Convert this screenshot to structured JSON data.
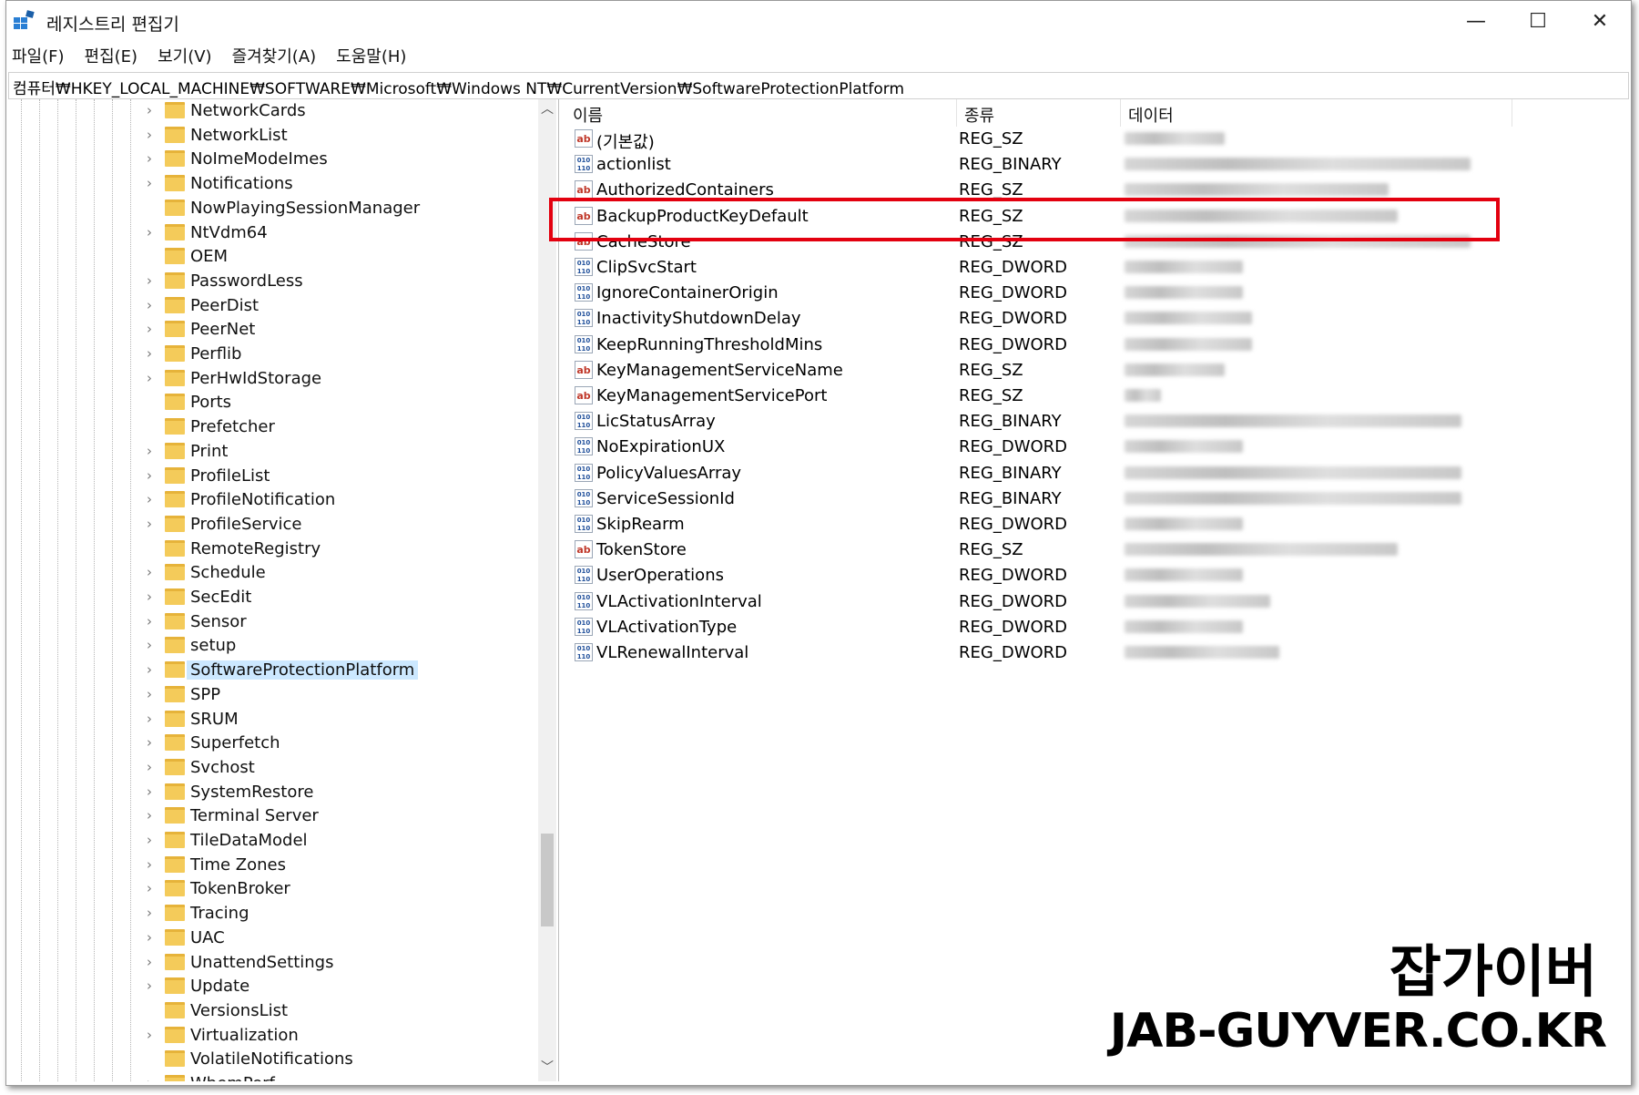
{
  "window": {
    "title": "레지스트리 편집기",
    "controls": {
      "minimize": "—",
      "maximize": "☐",
      "close": "✕"
    }
  },
  "menu": [
    "파일(F)",
    "편집(E)",
    "보기(V)",
    "즐겨찾기(A)",
    "도움말(H)"
  ],
  "address": "컴퓨터₩HKEY_LOCAL_MACHINE₩SOFTWARE₩Microsoft₩Windows NT₩CurrentVersion₩SoftwareProtectionPlatform",
  "tree": {
    "items": [
      {
        "label": "NetworkCards",
        "expandable": true
      },
      {
        "label": "NetworkList",
        "expandable": true
      },
      {
        "label": "NoImeModeImes",
        "expandable": true
      },
      {
        "label": "Notifications",
        "expandable": true
      },
      {
        "label": "NowPlayingSessionManager",
        "expandable": false
      },
      {
        "label": "NtVdm64",
        "expandable": true
      },
      {
        "label": "OEM",
        "expandable": false
      },
      {
        "label": "PasswordLess",
        "expandable": true
      },
      {
        "label": "PeerDist",
        "expandable": true
      },
      {
        "label": "PeerNet",
        "expandable": true
      },
      {
        "label": "Perflib",
        "expandable": true
      },
      {
        "label": "PerHwIdStorage",
        "expandable": true
      },
      {
        "label": "Ports",
        "expandable": false
      },
      {
        "label": "Prefetcher",
        "expandable": false
      },
      {
        "label": "Print",
        "expandable": true
      },
      {
        "label": "ProfileList",
        "expandable": true
      },
      {
        "label": "ProfileNotification",
        "expandable": true
      },
      {
        "label": "ProfileService",
        "expandable": true
      },
      {
        "label": "RemoteRegistry",
        "expandable": false
      },
      {
        "label": "Schedule",
        "expandable": true
      },
      {
        "label": "SecEdit",
        "expandable": true
      },
      {
        "label": "Sensor",
        "expandable": true
      },
      {
        "label": "setup",
        "expandable": true
      },
      {
        "label": "SoftwareProtectionPlatform",
        "expandable": true,
        "selected": true
      },
      {
        "label": "SPP",
        "expandable": true
      },
      {
        "label": "SRUM",
        "expandable": true
      },
      {
        "label": "Superfetch",
        "expandable": true
      },
      {
        "label": "Svchost",
        "expandable": true
      },
      {
        "label": "SystemRestore",
        "expandable": true
      },
      {
        "label": "Terminal Server",
        "expandable": true
      },
      {
        "label": "TileDataModel",
        "expandable": true
      },
      {
        "label": "Time Zones",
        "expandable": true
      },
      {
        "label": "TokenBroker",
        "expandable": true
      },
      {
        "label": "Tracing",
        "expandable": true
      },
      {
        "label": "UAC",
        "expandable": true
      },
      {
        "label": "UnattendSettings",
        "expandable": true
      },
      {
        "label": "Update",
        "expandable": true
      },
      {
        "label": "VersionsList",
        "expandable": false
      },
      {
        "label": "Virtualization",
        "expandable": true
      },
      {
        "label": "VolatileNotifications",
        "expandable": false
      },
      {
        "label": "WbemPerf",
        "expandable": true
      }
    ]
  },
  "list": {
    "headers": {
      "name": "이름",
      "type": "종류",
      "data": "데이터"
    },
    "rows": [
      {
        "name": "(기본값)",
        "type": "REG_SZ",
        "icon": "ab"
      },
      {
        "name": "actionlist",
        "type": "REG_BINARY",
        "icon": "bin"
      },
      {
        "name": "AuthorizedContainers",
        "type": "REG_SZ",
        "icon": "ab"
      },
      {
        "name": "BackupProductKeyDefault",
        "type": "REG_SZ",
        "icon": "ab"
      },
      {
        "name": "CacheStore",
        "type": "REG_SZ",
        "icon": "ab"
      },
      {
        "name": "ClipSvcStart",
        "type": "REG_DWORD",
        "icon": "bin"
      },
      {
        "name": "IgnoreContainerOrigin",
        "type": "REG_DWORD",
        "icon": "bin"
      },
      {
        "name": "InactivityShutdownDelay",
        "type": "REG_DWORD",
        "icon": "bin"
      },
      {
        "name": "KeepRunningThresholdMins",
        "type": "REG_DWORD",
        "icon": "bin"
      },
      {
        "name": "KeyManagementServiceName",
        "type": "REG_SZ",
        "icon": "ab"
      },
      {
        "name": "KeyManagementServicePort",
        "type": "REG_SZ",
        "icon": "ab"
      },
      {
        "name": "LicStatusArray",
        "type": "REG_BINARY",
        "icon": "bin"
      },
      {
        "name": "NoExpirationUX",
        "type": "REG_DWORD",
        "icon": "bin"
      },
      {
        "name": "PolicyValuesArray",
        "type": "REG_BINARY",
        "icon": "bin"
      },
      {
        "name": "ServiceSessionId",
        "type": "REG_BINARY",
        "icon": "bin"
      },
      {
        "name": "SkipRearm",
        "type": "REG_DWORD",
        "icon": "bin"
      },
      {
        "name": "TokenStore",
        "type": "REG_SZ",
        "icon": "ab"
      },
      {
        "name": "UserOperations",
        "type": "REG_DWORD",
        "icon": "bin"
      },
      {
        "name": "VLActivationInterval",
        "type": "REG_DWORD",
        "icon": "bin"
      },
      {
        "name": "VLActivationType",
        "type": "REG_DWORD",
        "icon": "bin"
      },
      {
        "name": "VLRenewalInterval",
        "type": "REG_DWORD",
        "icon": "bin"
      }
    ],
    "highlighted_row": "BackupProductKeyDefault"
  },
  "icons": {
    "string_value": "ab",
    "binary_value": "010 110"
  },
  "watermark": {
    "line1": "잡가이버",
    "line2": "JAB-GUYVER.CO.KR"
  },
  "colors": {
    "highlight_box": "#e3000f",
    "selection": "#cce8ff",
    "folder": "#f4cb5a"
  }
}
